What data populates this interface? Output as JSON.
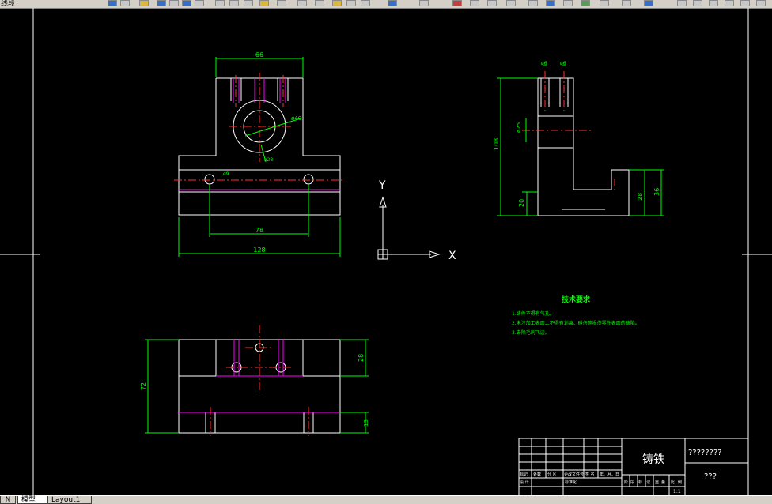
{
  "toolbar": {
    "label": "线段"
  },
  "tabs": {
    "nav": "N",
    "model": "模型",
    "layout": "Layout1"
  },
  "ucs": {
    "x_label": "X",
    "y_label": "Y"
  },
  "front_view": {
    "dim_top": "66",
    "dim_hole": "ø40",
    "dim_small": "ø23",
    "dim_slot": "ø9",
    "dim_inner": "78",
    "dim_bottom": "128"
  },
  "side_view": {
    "dim_top_left": "ø6",
    "dim_top_right": "ø6",
    "dim_bore": "ø25",
    "dim_height": "108",
    "dim_base": "20",
    "dim_step": "28",
    "dim_right": "36"
  },
  "top_view": {
    "dim_left": "72",
    "dim_top_right": "28",
    "dim_bottom_right": "13"
  },
  "tech_notes": {
    "title": "技术要求",
    "line1": "1.铸件不得有气孔。",
    "line2": "2.未注加工表面上不得有划痕、碰伤等损伤零件表面的缺陷。",
    "line3": "3.去除毛刺飞边。"
  },
  "title_block": {
    "material": "铸铁",
    "drawing_name": "????????",
    "drawing_no": "???",
    "scale": "1:1",
    "row_labels": [
      "标记",
      "处数",
      "分 区",
      "更改文件号",
      "签 名",
      "年、月、日"
    ],
    "designer": "设 计",
    "standardize": "标准化",
    "stage_labels": [
      "阶",
      "段",
      "标",
      "记",
      "重",
      "量",
      "比",
      "例"
    ]
  }
}
